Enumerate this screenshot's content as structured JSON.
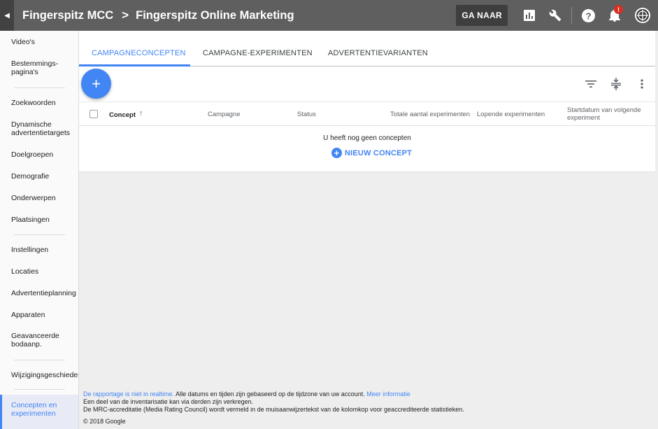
{
  "header": {
    "crumb_account": "Fingerspitz MCC",
    "crumb_separator": ">",
    "crumb_sub": "Fingerspitz Online Marketing",
    "goto_label": "GA NAAR",
    "notification_badge": "!"
  },
  "sidebar": {
    "items": [
      {
        "label": "Video's"
      },
      {
        "label": "Bestemmings-"
      },
      {
        "label": "pagina's"
      },
      {
        "label": "Zoekwoorden"
      },
      {
        "label": "Dynamische"
      },
      {
        "label": "advertentietargets"
      },
      {
        "label": "Doelgroepen"
      },
      {
        "label": "Demografie"
      },
      {
        "label": "Onderwerpen"
      },
      {
        "label": "Plaatsingen"
      },
      {
        "label": "Instellingen"
      },
      {
        "label": "Locaties"
      },
      {
        "label": "Advertentieplanning"
      },
      {
        "label": "Apparaten"
      },
      {
        "label": "Geavanceerde"
      },
      {
        "label": "bodaanp."
      },
      {
        "label": "Wijzigingsgeschiedenis"
      }
    ],
    "active_line1": "Concepten en",
    "active_line2": "experimenten"
  },
  "tabs": [
    {
      "label": "CAMPAGNECONCEPTEN",
      "active": true
    },
    {
      "label": "CAMPAGNE-EXPERIMENTEN",
      "active": false
    },
    {
      "label": "ADVERTENTIEVARIANTEN",
      "active": false
    }
  ],
  "table": {
    "columns": [
      "Concept",
      "Campagne",
      "Status",
      "Totale aantal experimenten",
      "Lopende experimenten",
      "Startdatum van volgende",
      "experiment"
    ],
    "sort_indicator": "↑",
    "empty_message": "U heeft nog geen concepten",
    "new_concept_label": "NIEUW CONCEPT"
  },
  "footer": {
    "link1": "De rapportage is niet in realtime.",
    "text1": " Alle datums en tijden zijn gebaseerd op de tijdzone van uw account. ",
    "link2": "Meer informatie",
    "line2": "Een deel van de inventarisatie kan via derden zijn verkregen.",
    "line3": "De MRC-accreditatie (Media Rating Council) wordt vermeld in de muisaanwijzertekst van de kolomkop voor geaccrediteerde statistieken.",
    "copyright": "© 2018 Google"
  },
  "colors": {
    "topbar": "#5f5f5f",
    "accent": "#4285f4",
    "badge": "#d93025"
  }
}
